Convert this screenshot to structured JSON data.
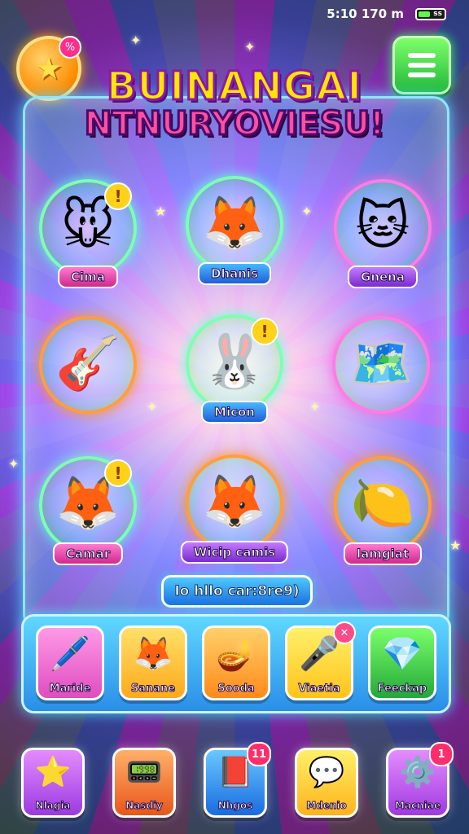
{
  "status": {
    "time": "5:10 170 m",
    "battery": "ss"
  },
  "title": {
    "line1": "BUINANGAI",
    "line2": "NTNURYOVIESU!"
  },
  "top_buttons": {
    "star_badge": "%"
  },
  "characters": [
    {
      "label": "Cima",
      "icon": "mouse-character",
      "art": "🐭",
      "alert": "!"
    },
    {
      "label": "Dhanis",
      "icon": "fox-character",
      "art": "🦊",
      "alert": ""
    },
    {
      "label": "Gnena",
      "icon": "cat-character",
      "art": "🐱",
      "alert": ""
    },
    {
      "label": "",
      "icon": "guitar-item",
      "art": "🎸",
      "alert": ""
    },
    {
      "label": "Micon",
      "icon": "bunny-character",
      "art": "🐰",
      "alert": "!"
    },
    {
      "label": "",
      "icon": "treasure-board-item",
      "art": "🗺️",
      "alert": ""
    },
    {
      "label": "Camar",
      "icon": "fox-girl-character",
      "art": "🦊",
      "alert": "!"
    },
    {
      "label": "Wicip camis",
      "icon": "orange-fox-character",
      "art": "🦊",
      "alert": ""
    },
    {
      "label": "lamgiat",
      "icon": "lemon-key-item",
      "art": "🍋",
      "alert": ""
    }
  ],
  "action_pill": "Io hllo car:8re9)",
  "tray_items": [
    {
      "label": "Maride",
      "icon": "pen-icon",
      "art": "🖊️",
      "color": "#ff7bd6",
      "badge": ""
    },
    {
      "label": "Sanane",
      "icon": "fox-face-icon",
      "art": "🦊",
      "color": "#ffc02a",
      "badge": ""
    },
    {
      "label": "Sooda",
      "icon": "lamp-icon",
      "art": "🪔",
      "color": "#ffb02a",
      "badge": ""
    },
    {
      "label": "Viaetia",
      "icon": "microphone-icon",
      "art": "🎤",
      "color": "#ffd22a",
      "badge": "✕"
    },
    {
      "label": "Feeckap",
      "icon": "crystal-icon",
      "art": "💎",
      "color": "#3ec23a",
      "badge": ""
    }
  ],
  "nav_items": [
    {
      "label": "Nlagia",
      "icon": "star-icon",
      "art": "⭐",
      "color": "#c65bff",
      "badge": ""
    },
    {
      "label": "Nasdiy",
      "icon": "tablet-icon",
      "art": "📟",
      "color": "#ff7a2a",
      "badge": ""
    },
    {
      "label": "Nhgos",
      "icon": "book-icon",
      "art": "📕",
      "color": "#2a9cff",
      "badge": "11"
    },
    {
      "label": "Mdenio",
      "icon": "chat-icon",
      "art": "💬",
      "color": "#ffcf2a",
      "badge": ""
    },
    {
      "label": "Macniae",
      "icon": "gear-icon",
      "art": "⚙️",
      "color": "#c56bff",
      "badge": "1"
    }
  ]
}
